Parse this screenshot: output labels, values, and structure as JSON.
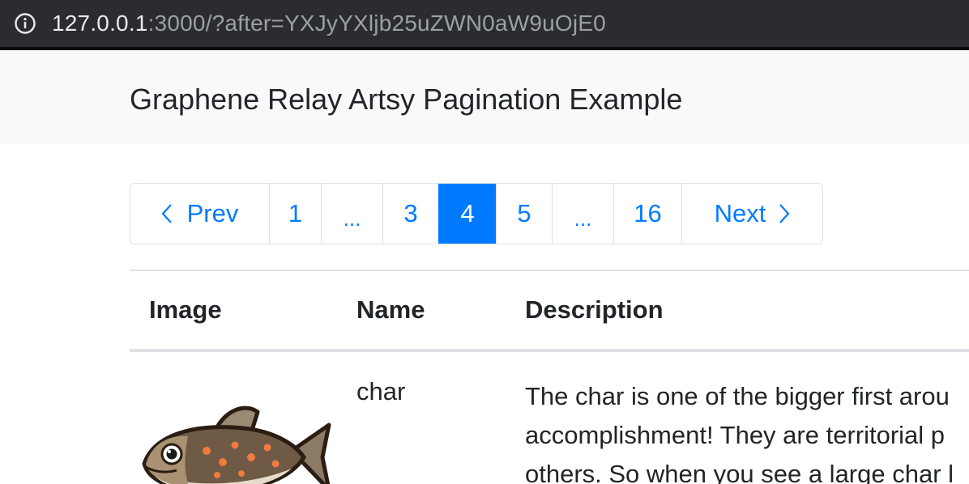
{
  "browser": {
    "url_host": "127.0.0.1",
    "url_rest": ":3000/?after=YXJyYXljb25uZWN0aW9uOjE0",
    "icons": {
      "site_info": "info-icon"
    }
  },
  "navbar": {
    "brand": "Graphene Relay Artsy Pagination Example"
  },
  "pagination": {
    "prev_label": "Prev",
    "next_label": "Next",
    "pages": [
      "1",
      "...",
      "3",
      "4",
      "5",
      "...",
      "16"
    ],
    "active_page": "4"
  },
  "table": {
    "headers": {
      "image": "Image",
      "name": "Name",
      "description": "Description"
    },
    "rows": [
      {
        "image": "fish-image",
        "name": "char",
        "description_lines": [
          "The char is one of the bigger first arou",
          "accomplishment! They are territorial p",
          "others. So when you see a large char l"
        ]
      }
    ]
  }
}
